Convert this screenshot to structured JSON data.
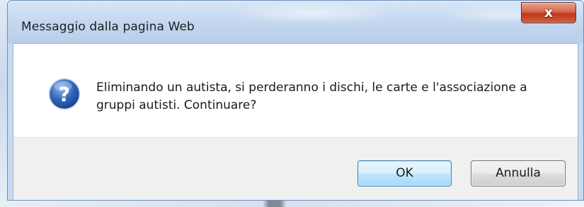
{
  "dialog": {
    "title": "Messaggio dalla pagina Web",
    "close_glyph": "x",
    "icon": "question-icon",
    "message": "Eliminando un autista, si perderanno i dischi, le carte e l'associazione a gruppi autisti. Continuare?",
    "buttons": {
      "ok_label": "OK",
      "cancel_label": "Annulla"
    }
  },
  "colors": {
    "titlebar": "#c2d6ee",
    "close_button": "#c1391e",
    "icon_blue": "#2a5fb0",
    "default_button_border": "#3c7fb1",
    "footer": "#f0f0f0"
  }
}
